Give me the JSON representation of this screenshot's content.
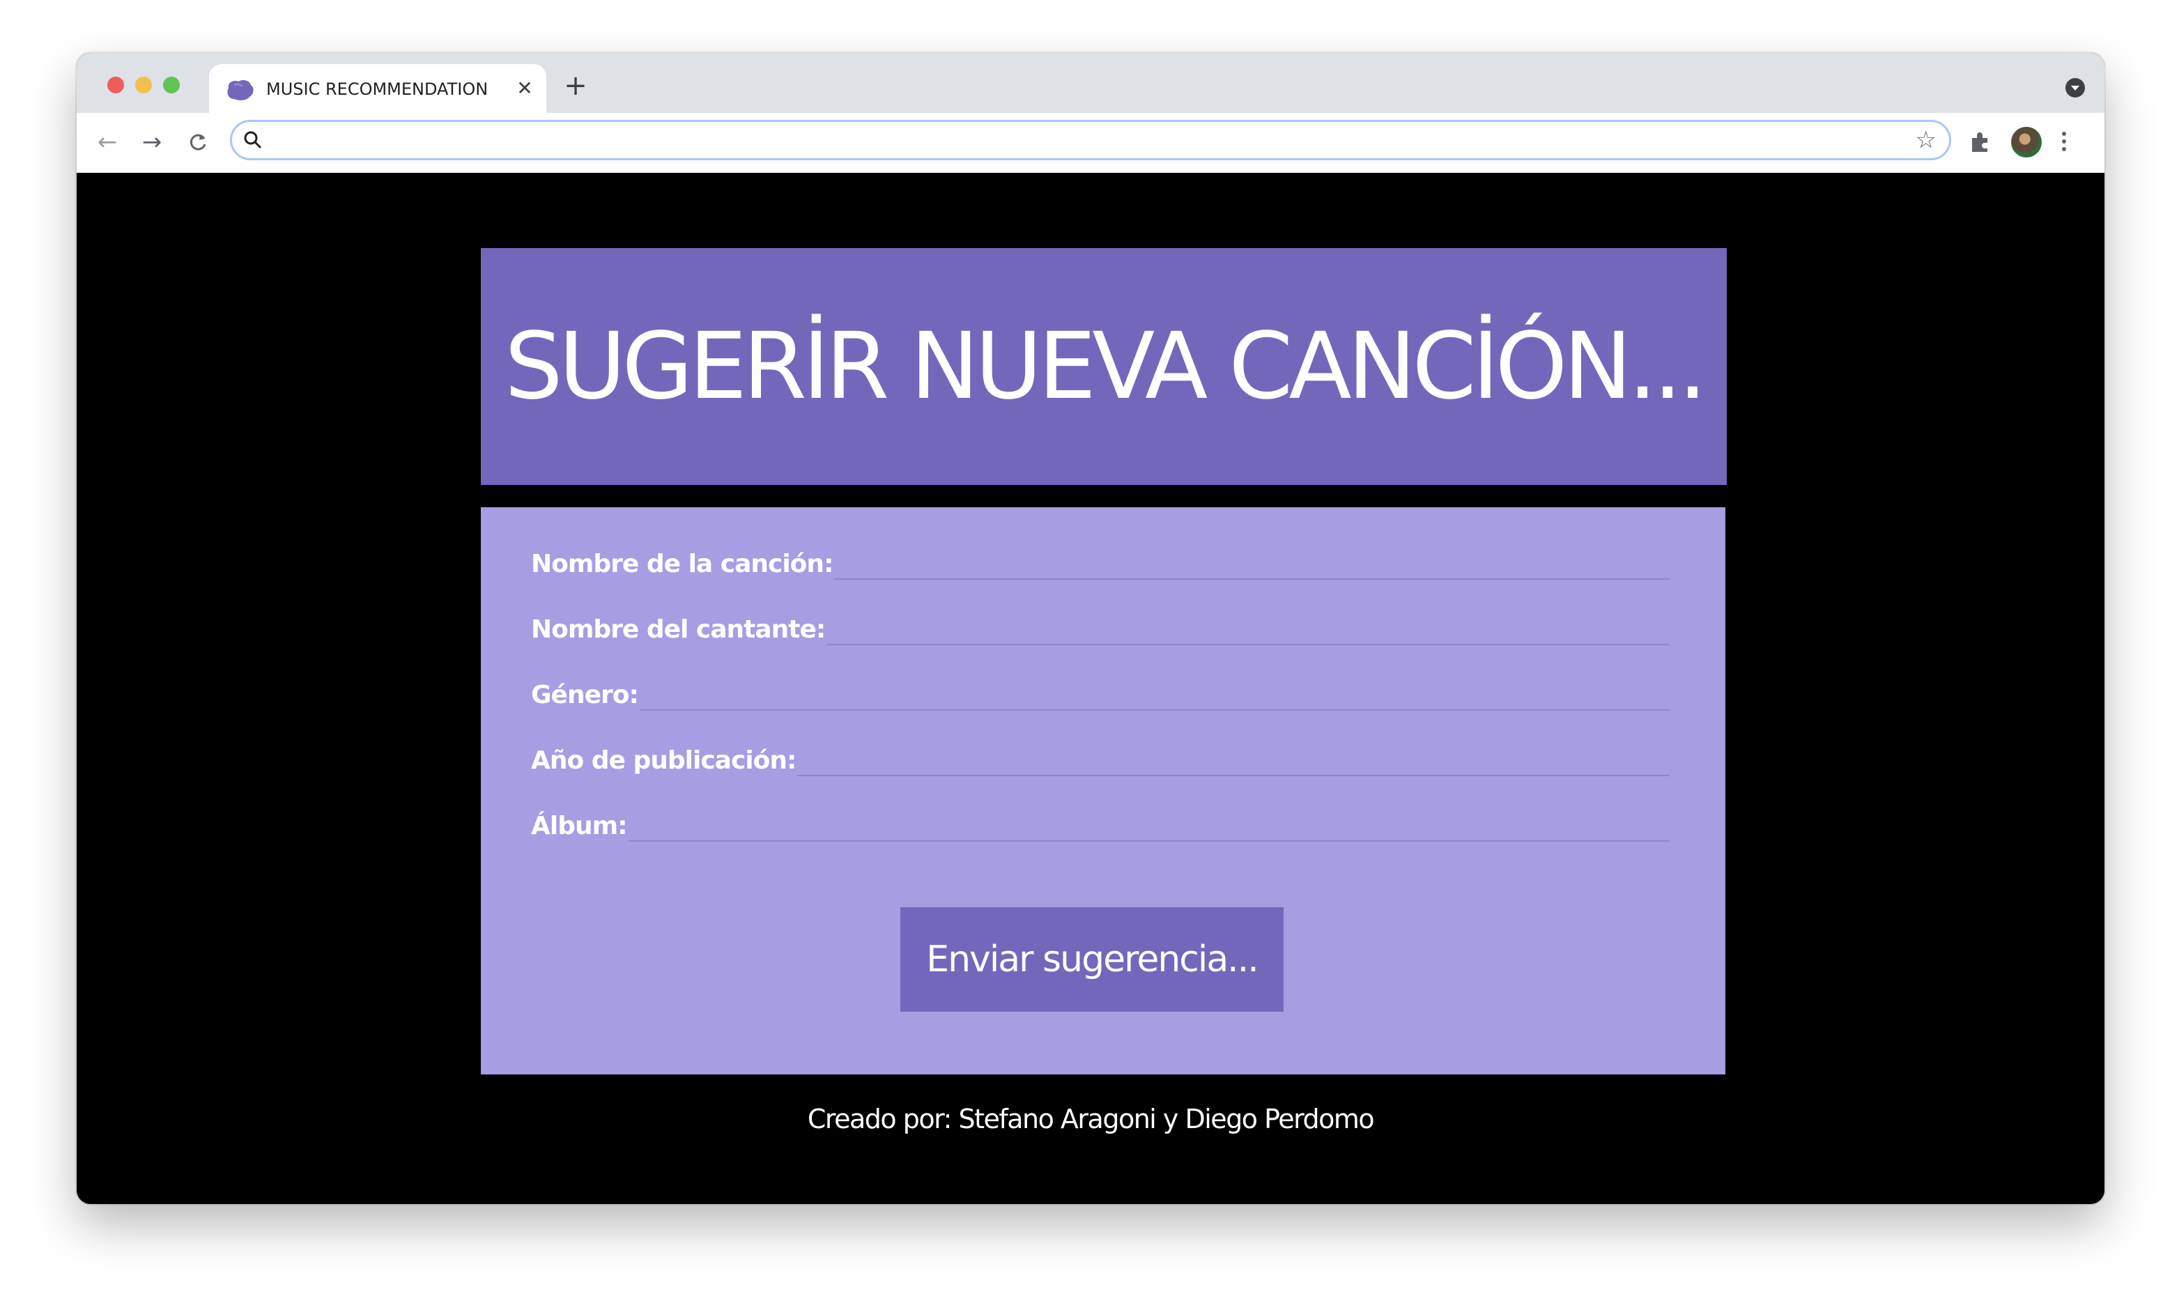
{
  "browser": {
    "tab_title": "MUSIC RECOMMENDATION",
    "address_value": "",
    "colors": {
      "tabstrip": "#dee1e6",
      "omnibox_border": "#a8c7fa"
    }
  },
  "page": {
    "heading": "SUGERİR NUEVA CANCİÓN...",
    "form": {
      "fields": [
        {
          "label": "Nombre de la canción:",
          "value": ""
        },
        {
          "label": "Nombre del cantante:",
          "value": ""
        },
        {
          "label": "Género:",
          "value": ""
        },
        {
          "label": "Año de publicación:",
          "value": ""
        },
        {
          "label": "Álbum:",
          "value": ""
        }
      ],
      "submit_label": "Enviar sugerencia..."
    },
    "footer": "Creado por: Stefano Aragoni y Diego Perdomo",
    "colors": {
      "background": "#000000",
      "header_bg": "#7367bc",
      "form_bg": "#a69de3",
      "button_bg": "#7367bc",
      "text": "#ffffff"
    }
  },
  "icons": {
    "favicon": "purple-blob-icon",
    "back": "arrow-left-icon",
    "forward": "arrow-right-icon",
    "reload": "reload-icon",
    "search": "search-icon",
    "bookmark": "star-icon",
    "extensions": "puzzle-icon",
    "menu": "kebab-menu-icon"
  }
}
